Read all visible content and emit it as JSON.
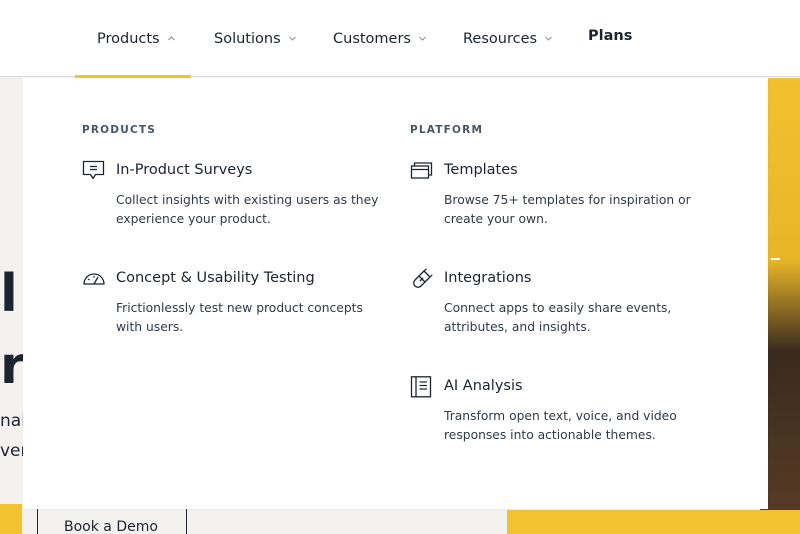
{
  "nav": {
    "items": [
      {
        "label": "Products",
        "active": true,
        "chevron": "chevron-up-icon"
      },
      {
        "label": "Solutions",
        "active": false,
        "chevron": "chevron-down-icon"
      },
      {
        "label": "Customers",
        "active": false,
        "chevron": "chevron-down-icon"
      },
      {
        "label": "Resources",
        "active": false,
        "chevron": "chevron-down-icon"
      },
      {
        "label": "Plans",
        "active": false
      }
    ],
    "accent_color": "#f2c230"
  },
  "dropdown": {
    "products": {
      "heading": "PRODUCTS",
      "items": [
        {
          "icon": "survey-chat-icon",
          "title": "In-Product Surveys",
          "description": "Collect insights with existing users as they experience your product."
        },
        {
          "icon": "gauge-icon",
          "title": "Concept & Usability Testing",
          "description": "Frictionlessly test new product concepts with users."
        }
      ]
    },
    "platform": {
      "heading": "PLATFORM",
      "items": [
        {
          "icon": "templates-icon",
          "title": "Templates",
          "description": "Browse 75+ templates for inspiration or create your own."
        },
        {
          "icon": "integrations-magnet-icon",
          "title": "Integrations",
          "description": "Connect apps to easily share events, attributes, and insights."
        },
        {
          "icon": "notebook-icon",
          "title": "AI Analysis",
          "description": "Transform open text, voice, and video responses into actionable themes."
        }
      ]
    }
  },
  "hero": {
    "heading_line_1": "l",
    "heading_line_2": "r",
    "sub_line_1": "nal",
    "sub_line_2": "ver",
    "demo_button": "Book a Demo"
  }
}
